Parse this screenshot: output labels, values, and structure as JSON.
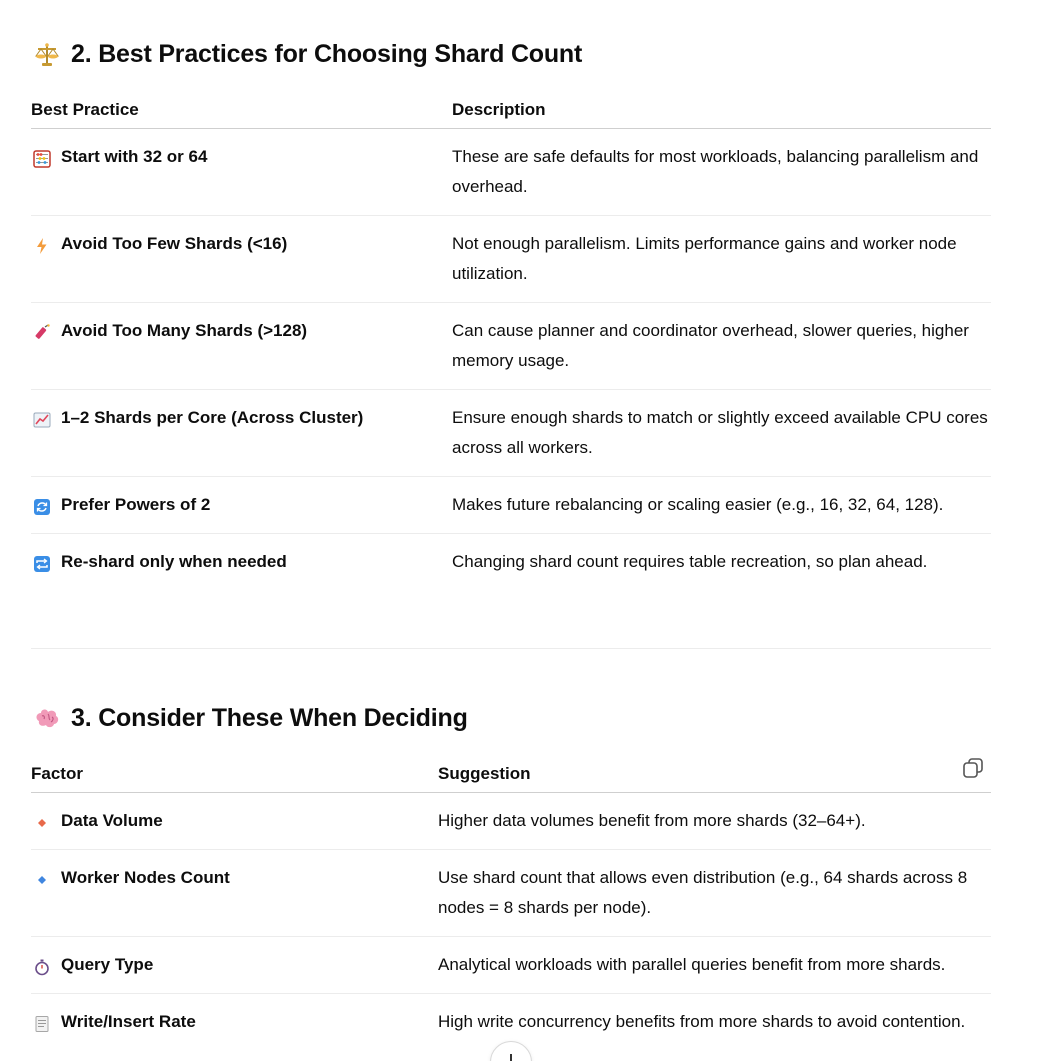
{
  "section2": {
    "title": "2. Best Practices for Choosing Shard Count",
    "icon": "balance-scale-icon",
    "headers": [
      "Best Practice",
      "Description"
    ],
    "rows": [
      {
        "icon": "abacus-icon",
        "practice": "Start with 32 or 64",
        "description": "These are safe defaults for most workloads, balancing parallelism and overhead."
      },
      {
        "icon": "lightning-icon",
        "practice": "Avoid Too Few Shards (<16)",
        "description": "Not enough parallelism. Limits performance gains and worker node utilization."
      },
      {
        "icon": "firecracker-icon",
        "practice": "Avoid Too Many Shards (>128)",
        "description": "Can cause planner and coordinator overhead, slower queries, higher memory usage."
      },
      {
        "icon": "chart-increasing-icon",
        "practice": "1–2 Shards per Core (Across Cluster)",
        "description": "Ensure enough shards to match or slightly exceed available CPU cores across all workers."
      },
      {
        "icon": "counterclockwise-arrows-icon",
        "practice": "Prefer Powers of 2",
        "description": "Makes future rebalancing or scaling easier (e.g., 16, 32, 64, 128)."
      },
      {
        "icon": "repeat-icon",
        "practice": "Re-shard only when needed",
        "description": "Changing shard count requires table recreation, so plan ahead."
      }
    ]
  },
  "section3": {
    "title": "3. Consider These When Deciding",
    "icon": "brain-icon",
    "headers": [
      "Factor",
      "Suggestion"
    ],
    "rows": [
      {
        "icon": "orange-diamond-icon",
        "factor": "Data Volume",
        "suggestion": "Higher data volumes benefit from more shards (32–64+)."
      },
      {
        "icon": "blue-diamond-icon",
        "factor": "Worker Nodes Count",
        "suggestion": "Use shard count that allows even distribution (e.g., 64 shards across 8 nodes = 8 shards per node)."
      },
      {
        "icon": "stopwatch-icon",
        "factor": "Query Type",
        "suggestion": "Analytical workloads with parallel queries benefit from more shards."
      },
      {
        "icon": "page-icon",
        "factor": "Write/Insert Rate",
        "suggestion": "High write concurrency benefits from more shards to avoid contention."
      }
    ]
  },
  "controls": {
    "copy_icon": "copy-icon",
    "scroll_icon": "arrow-down-icon"
  }
}
